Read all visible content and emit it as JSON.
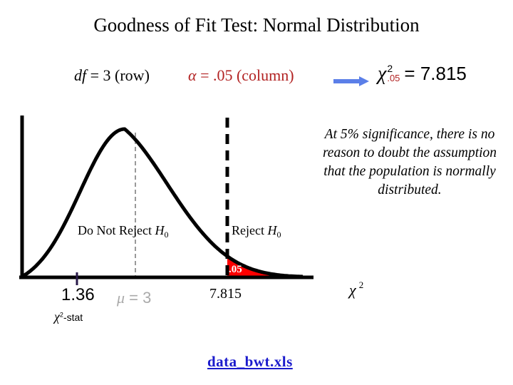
{
  "title": "Goodness of Fit Test:  Normal Distribution",
  "df_label": {
    "symbol": "df",
    "text": " = 3 (row)"
  },
  "alpha_label": {
    "symbol": "α",
    "text": " = .05 (column)"
  },
  "critical_formula": {
    "symbol": "χ",
    "superscript": "2",
    "subscript": ".05",
    "text": "= 7.815"
  },
  "conclusion": "At 5% significance, there is no reason to doubt the assumption that the population is normally distributed.",
  "regions": {
    "do_not_reject": {
      "text": "Do Not Reject ",
      "hyp": "H",
      "sub": "0"
    },
    "reject": {
      "text": "Reject ",
      "hyp": "H",
      "sub": "0"
    },
    "alpha_area": ".05"
  },
  "ticks": {
    "stat_value": "1.36",
    "stat_label": {
      "symbol": "χ",
      "sup": "2",
      "text": "-stat"
    },
    "mean": {
      "symbol": "μ",
      "text": " = 3"
    },
    "critical": "7.815"
  },
  "axis_label": {
    "symbol": "χ",
    "sup": "2"
  },
  "file_link": "data_bwt.xls",
  "colors": {
    "alpha_text": "#b22222",
    "reject_fill": "#ff0000",
    "arrow": "#5b7fe8",
    "stat_tick": "#2a1a4a",
    "mean_line": "#999999",
    "link": "#1a1acc"
  },
  "chart_data": {
    "type": "area",
    "distribution": "chi-square",
    "df": 3,
    "alpha": 0.05,
    "critical_value": 7.815,
    "test_statistic": 1.36,
    "mean": 3,
    "xlabel": "χ²",
    "regions": [
      "Do Not Reject H0",
      "Reject H0"
    ],
    "shaded_tail_area": 0.05
  }
}
